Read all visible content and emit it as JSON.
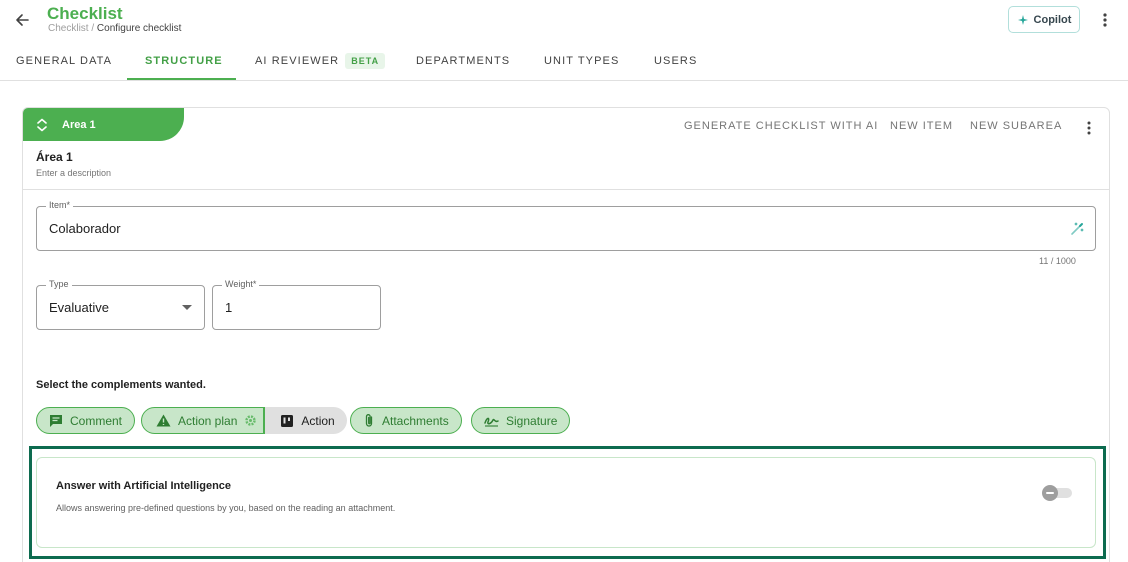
{
  "header": {
    "title": "Checklist",
    "breadcrumb_root": "Checklist",
    "breadcrumb_sep": " / ",
    "breadcrumb_current": "Configure checklist",
    "copilot_label": "Copilot",
    "back_icon": "arrow-left-icon",
    "menu_icon": "more-vertical-icon"
  },
  "tabs": [
    {
      "label": "GENERAL DATA",
      "active": false
    },
    {
      "label": "STRUCTURE",
      "active": true
    },
    {
      "label": "AI REVIEWER",
      "badge": "BETA",
      "active": false
    },
    {
      "label": "DEPARTMENTS",
      "active": false
    },
    {
      "label": "UNIT TYPES",
      "active": false
    },
    {
      "label": "USERS",
      "active": false
    }
  ],
  "area": {
    "tab_label": "Area 1",
    "name": "Área 1",
    "description": "Enter a description",
    "actions": {
      "generate": "GENERATE CHECKLIST WITH AI",
      "new_item": "NEW ITEM",
      "new_subarea": "NEW SUBAREA"
    }
  },
  "item": {
    "label": "Item*",
    "value": "Colaborador",
    "counter": "11 / 1000"
  },
  "type": {
    "label": "Type",
    "value": "Evaluative"
  },
  "weight": {
    "label": "Weight*",
    "value": "1"
  },
  "complements": {
    "heading": "Select the complements wanted.",
    "comment": "Comment",
    "action_plan": "Action plan",
    "action": "Action",
    "attachments": "Attachments",
    "signature": "Signature"
  },
  "ai_answer": {
    "title": "Answer with Artificial Intelligence",
    "description": "Allows answering pre-defined questions by you, based on the reading an attachment.",
    "enabled": false
  },
  "colors": {
    "accent": "#4caf50",
    "chip_bg": "#c8e6c9",
    "highlight_outline": "#0d6b4f"
  }
}
